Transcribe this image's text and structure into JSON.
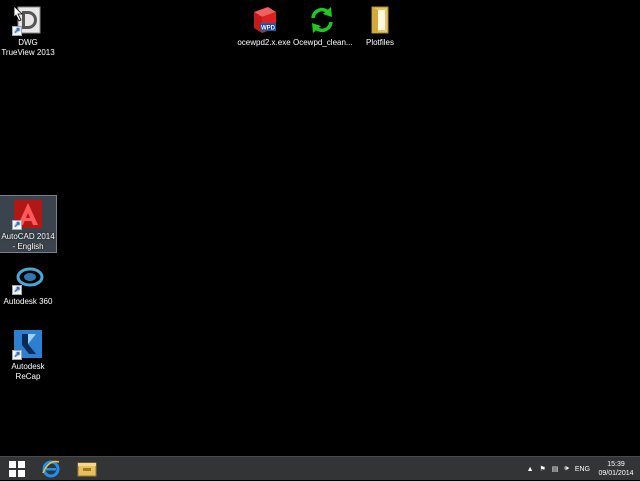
{
  "desktop_icons": [
    {
      "id": "dwg",
      "label": "DWG TrueView 2013",
      "icon": "dwg-trueview-icon"
    },
    {
      "id": "ocewpd",
      "label": "ocewpd2.x.exe",
      "icon": "ocewpd-installer-icon"
    },
    {
      "id": "cleaner",
      "label": "Ocewpd_clean...",
      "icon": "refresh-arrows-icon"
    },
    {
      "id": "plotfiles",
      "label": "Plotfiles",
      "icon": "folder-icon"
    },
    {
      "id": "autocad",
      "label": "AutoCAD 2014 - English",
      "icon": "autocad-icon",
      "selected": true
    },
    {
      "id": "a360",
      "label": "Autodesk 360",
      "icon": "autodesk-360-icon"
    },
    {
      "id": "recap",
      "label": "Autodesk ReCap",
      "icon": "autodesk-recap-icon"
    }
  ],
  "taskbar": {
    "start_icon": "windows-logo-icon",
    "pinned": [
      {
        "name": "internet-explorer",
        "icon": "internet-explorer-icon"
      },
      {
        "name": "file-explorer",
        "icon": "file-explorer-icon"
      }
    ],
    "tray": {
      "language": "ENG",
      "time": "15:39",
      "date": "09/01/2014"
    }
  },
  "colors": {
    "taskbar": "#333436",
    "desktop": "#000000",
    "selection": "#8296aa"
  }
}
